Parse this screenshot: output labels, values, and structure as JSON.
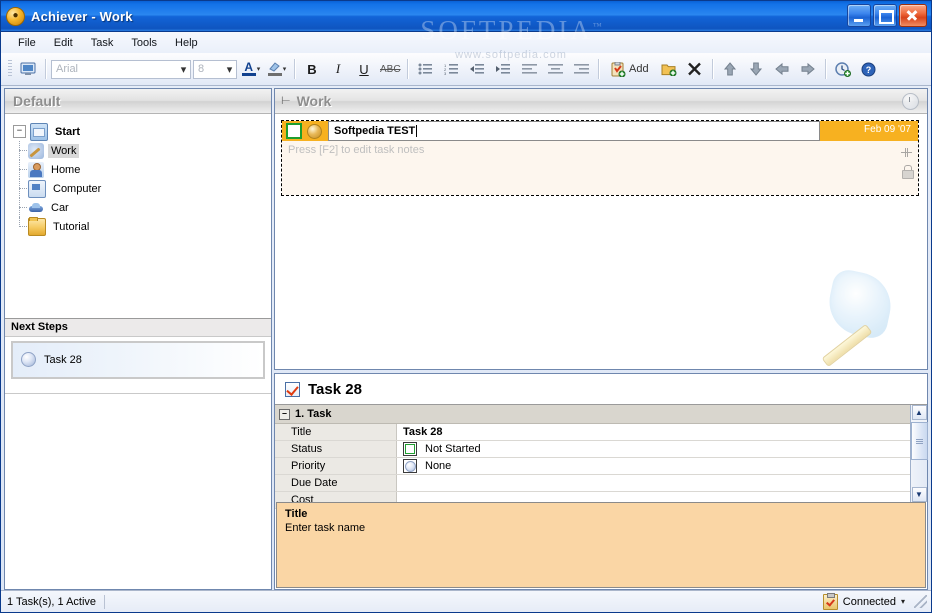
{
  "window": {
    "title": "Achiever - Work",
    "app_icon": "achiever-icon",
    "minimize_label": "Minimize",
    "maximize_label": "Maximize",
    "close_label": "Close"
  },
  "watermark": {
    "main": "SOFTPEDIA",
    "tm": "™",
    "sub": "www.softpedia.com"
  },
  "menu": {
    "items": [
      {
        "label": "File"
      },
      {
        "label": "Edit"
      },
      {
        "label": "Task"
      },
      {
        "label": "Tools"
      },
      {
        "label": "Help"
      }
    ]
  },
  "toolbar": {
    "screen_icon": "monitor-icon",
    "font_name": "Arial",
    "font_size": "8",
    "font_color_label": "A",
    "highlight_label": "ab",
    "bold_label": "B",
    "italic_label": "I",
    "underline_label": "U",
    "strike_label": "ABC",
    "add_label": "Add",
    "buttons": [
      {
        "name": "bullet-list-icon",
        "glyph": "☰"
      },
      {
        "name": "numbered-list-icon",
        "glyph": "≡"
      },
      {
        "name": "decrease-indent-icon",
        "glyph": "⇤"
      },
      {
        "name": "increase-indent-icon",
        "glyph": "⇥"
      },
      {
        "name": "align-left-icon",
        "glyph": "▤"
      },
      {
        "name": "align-center-icon",
        "glyph": "▤"
      },
      {
        "name": "align-right-icon",
        "glyph": "▤"
      },
      {
        "name": "add-folder-icon",
        "glyph": "🗀"
      },
      {
        "name": "delete-icon",
        "glyph": "✕"
      },
      {
        "name": "move-up-icon",
        "glyph": "⬆"
      },
      {
        "name": "move-down-icon",
        "glyph": "⬇"
      },
      {
        "name": "move-left-icon",
        "glyph": "⬅"
      },
      {
        "name": "move-right-icon",
        "glyph": "➡"
      },
      {
        "name": "reminder-icon",
        "glyph": "◷"
      },
      {
        "name": "help-icon",
        "glyph": "?"
      }
    ]
  },
  "sidebar": {
    "header": "Default",
    "root": {
      "label": "Start",
      "expander": "−",
      "icon": "home-folder-icon"
    },
    "items": [
      {
        "label": "Work",
        "icon": "work-icon",
        "selected": true
      },
      {
        "label": "Home",
        "icon": "person-icon",
        "selected": false
      },
      {
        "label": "Computer",
        "icon": "computer-icon",
        "selected": false
      },
      {
        "label": "Car",
        "icon": "car-icon",
        "selected": false
      },
      {
        "label": "Tutorial",
        "icon": "folder-icon",
        "selected": false
      }
    ],
    "next_steps": {
      "header": "Next Steps",
      "items": [
        {
          "label": "Task 28",
          "icon": "priority-none-icon"
        }
      ]
    }
  },
  "tasklist": {
    "header": "Work",
    "context_icon": "tree-node-icon",
    "clock_icon": "clock-icon",
    "task": {
      "title_value": "Softpedia TEST",
      "notes_placeholder": "Press [F2] to edit task notes",
      "date": "Feb 09 '07",
      "checkbox_icon": "task-checkbox",
      "priority_icon": "priority-icon",
      "pin_icon": "pin-icon",
      "lock_icon": "lock-icon"
    }
  },
  "detail": {
    "title": "Task 28",
    "checked_icon": "checked-task-icon",
    "group": {
      "number_label": "1. Task",
      "expander": "−"
    },
    "rows": [
      {
        "label": "Title",
        "value": "Task 28",
        "icon": "",
        "bold": true
      },
      {
        "label": "Status",
        "value": "Not Started",
        "icon": "status-icon",
        "bold": false
      },
      {
        "label": "Priority",
        "value": "None",
        "icon": "priority-icon",
        "bold": false
      },
      {
        "label": "Due Date",
        "value": "",
        "icon": "",
        "bold": false
      },
      {
        "label": "Cost",
        "value": "",
        "icon": "",
        "bold": false
      }
    ],
    "scroll": {
      "up": "▲",
      "down": "▼"
    },
    "help": {
      "title": "Title",
      "text": "Enter task name"
    }
  },
  "statusbar": {
    "left": "1 Task(s), 1 Active",
    "connection_icon": "clipboard-check-icon",
    "connection": "Connected",
    "dropdown": "▼"
  },
  "colors": {
    "title_blue": "#1372e8",
    "task_orange": "#f7b120",
    "help_peach": "#fad6a5",
    "group_gray": "#d9d6ce"
  }
}
